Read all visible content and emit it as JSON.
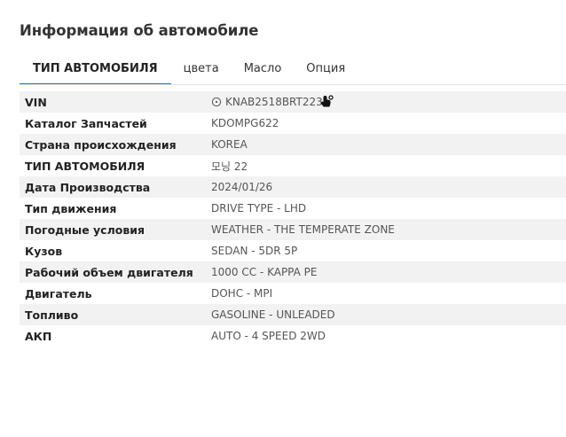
{
  "page": {
    "title": "Информация об автомобиле"
  },
  "tabs": [
    {
      "label": "ТИП АВТОМОБИЛЯ",
      "active": true
    },
    {
      "label": "цвета",
      "active": false
    },
    {
      "label": "Масло",
      "active": false
    },
    {
      "label": "Опция",
      "active": false
    }
  ],
  "rows": [
    {
      "label": "VIN",
      "value": "KNAB2518BRT223"
    },
    {
      "label": "Каталог Запчастей",
      "value": "KDOMPG622"
    },
    {
      "label": "Страна происхождения",
      "value": "KOREA"
    },
    {
      "label": "ТИП АВТОМОБИЛЯ",
      "value": "모닝 22"
    },
    {
      "label": "Дата Производства",
      "value": "2024/01/26"
    },
    {
      "label": "Тип движения",
      "value": "DRIVE TYPE - LHD"
    },
    {
      "label": "Погодные условия",
      "value": "WEATHER - THE TEMPERATE ZONE"
    },
    {
      "label": "Кузов",
      "value": "SEDAN - 5DR 5P"
    },
    {
      "label": "Рабочий объем двигателя",
      "value": "1000 CC - KAPPA PE"
    },
    {
      "label": "Двигатель",
      "value": "DOHC - MPI"
    },
    {
      "label": "Топливо",
      "value": "GASOLINE - UNLEADED"
    },
    {
      "label": "АКП",
      "value": "AUTO - 4 SPEED 2WD"
    }
  ],
  "icons": {
    "vin_icon": "info-circle-icon",
    "cursor": "hand-pointer-cursor-icon"
  },
  "colors": {
    "accent": "#2d6fb1",
    "row_stripe": "#f2f2f2"
  }
}
